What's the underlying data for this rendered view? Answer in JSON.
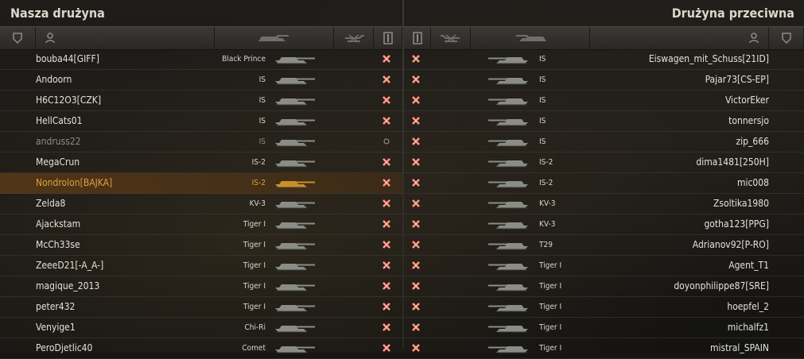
{
  "teams": {
    "ally_title": "Nasza drużyna",
    "enemy_title": "Drużyna przeciwna"
  },
  "header_icons": [
    "platoon-icon",
    "player-icon",
    "vehicle-icon",
    "kills-icon",
    "tier-icon"
  ],
  "ally": [
    {
      "player": "bouba44[GIFF]",
      "vehicle": "Black Prince",
      "status": "destroyed"
    },
    {
      "player": "Andoorn",
      "vehicle": "IS",
      "status": "destroyed"
    },
    {
      "player": "H6C12O3[CZK]",
      "vehicle": "IS",
      "status": "destroyed"
    },
    {
      "player": "HellCats01",
      "vehicle": "IS",
      "status": "destroyed"
    },
    {
      "player": "andruss22",
      "vehicle": "IS",
      "status": "disconnected"
    },
    {
      "player": "MegaCrun",
      "vehicle": "IS-2",
      "status": "destroyed"
    },
    {
      "player": "Nondrolon[BAJKA]",
      "vehicle": "IS-2",
      "status": "destroyed",
      "highlight": true
    },
    {
      "player": "Zelda8",
      "vehicle": "KV-3",
      "status": "destroyed"
    },
    {
      "player": "Ajackstam",
      "vehicle": "Tiger I",
      "status": "destroyed"
    },
    {
      "player": "McCh33se",
      "vehicle": "Tiger I",
      "status": "destroyed"
    },
    {
      "player": "ZeeeD21[-A_A-]",
      "vehicle": "Tiger I",
      "status": "destroyed"
    },
    {
      "player": "magique_2013",
      "vehicle": "Tiger I",
      "status": "destroyed"
    },
    {
      "player": "peter432",
      "vehicle": "Tiger I",
      "status": "destroyed"
    },
    {
      "player": "Venyige1",
      "vehicle": "Chi-Ri",
      "status": "destroyed"
    },
    {
      "player": "PeroDjetlic40",
      "vehicle": "Comet",
      "status": "destroyed"
    }
  ],
  "enemy": [
    {
      "player": "Eiswagen_mit_Schuss[21ID]",
      "vehicle": "IS",
      "status": "destroyed"
    },
    {
      "player": "Pajar73[CS-EP]",
      "vehicle": "IS",
      "status": "destroyed"
    },
    {
      "player": "VictorEker",
      "vehicle": "IS",
      "status": "destroyed"
    },
    {
      "player": "tonnersjo",
      "vehicle": "IS",
      "status": "destroyed"
    },
    {
      "player": "zip_666",
      "vehicle": "IS",
      "status": "destroyed"
    },
    {
      "player": "dima1481[250H]",
      "vehicle": "IS-2",
      "status": "destroyed"
    },
    {
      "player": "mic008",
      "vehicle": "IS-2",
      "status": "destroyed"
    },
    {
      "player": "Zsoltika1980",
      "vehicle": "KV-3",
      "status": "destroyed"
    },
    {
      "player": "gotha123[PPG]",
      "vehicle": "KV-3",
      "status": "destroyed"
    },
    {
      "player": "Adrianov92[P-RO]",
      "vehicle": "T29",
      "status": "destroyed"
    },
    {
      "player": "Agent_T1",
      "vehicle": "Tiger I",
      "status": "destroyed"
    },
    {
      "player": "doyonphilippe87[SRE]",
      "vehicle": "Tiger I",
      "status": "destroyed"
    },
    {
      "player": "hoepfel_2",
      "vehicle": "Tiger I",
      "status": "destroyed"
    },
    {
      "player": "michalfz1",
      "vehicle": "Tiger I",
      "status": "destroyed"
    },
    {
      "player": "mistral_SPAIN",
      "vehicle": "Tiger I",
      "status": "destroyed"
    }
  ],
  "colors": {
    "destroyed": "#f0c8b8",
    "destroyed_stroke": "#d84a3a",
    "highlight": "#e0a040",
    "tank": "#8a8d86",
    "tank_highlight": "#c8902a"
  }
}
